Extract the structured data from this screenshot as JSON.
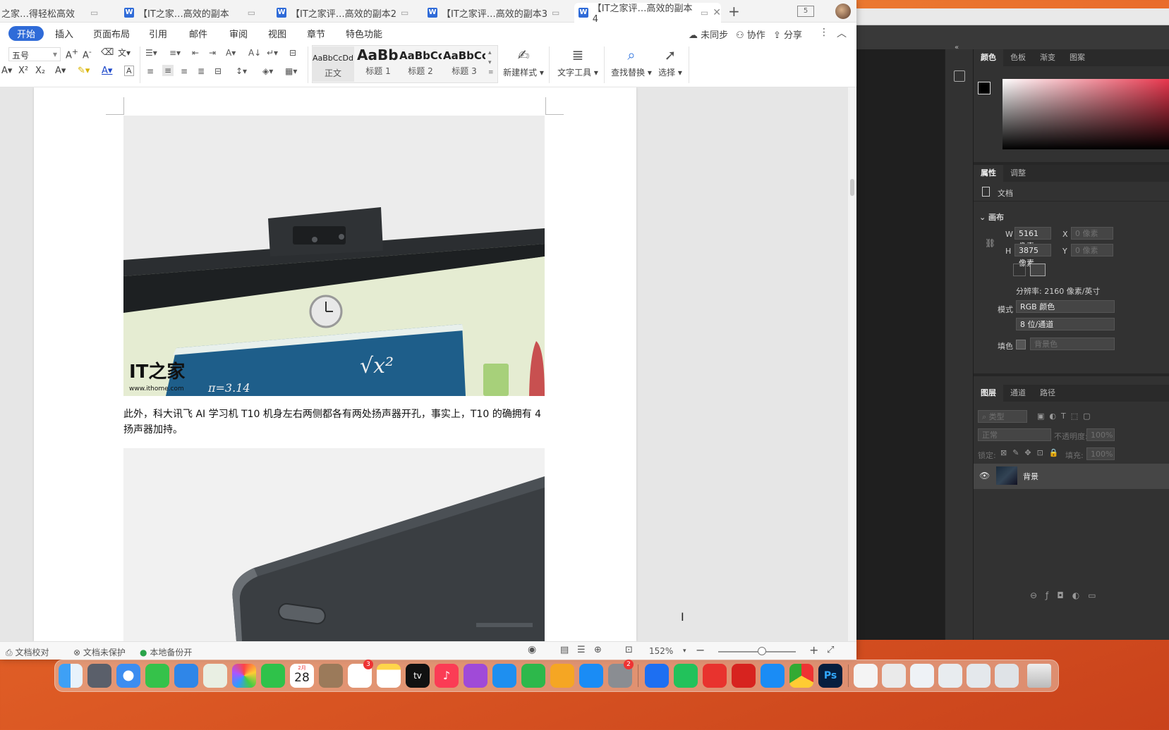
{
  "wps": {
    "tabs": [
      {
        "label": "之家…得轻松高效",
        "active": false
      },
      {
        "label": "【IT之家…高效的副本",
        "active": false
      },
      {
        "label": "【IT之家评…高效的副本2",
        "active": false
      },
      {
        "label": "【IT之家评…高效的副本3",
        "active": false
      },
      {
        "label": "【IT之家评…高效的副本4",
        "active": true
      }
    ],
    "tab_count": "5",
    "menu": [
      "开始",
      "插入",
      "页面布局",
      "引用",
      "邮件",
      "审阅",
      "视图",
      "章节",
      "特色功能"
    ],
    "right_actions": {
      "sync": "未同步",
      "collab": "协作",
      "share": "分享"
    },
    "ribbon": {
      "font_size": "五号",
      "styles": [
        {
          "preview": "AaBbCcDd",
          "name": "正文"
        },
        {
          "preview": "AaBb(",
          "name": "标题 1"
        },
        {
          "preview": "AaBbCc",
          "name": "标题 2"
        },
        {
          "preview": "AaBbCc",
          "name": "标题 3"
        }
      ],
      "new_style": "新建样式",
      "text_tools": "文字工具",
      "find_replace": "查找替换",
      "select": "选择"
    },
    "paragraph": "此外，科大讯飞 AI 学习机 T10 机身左右两侧都各有两处扬声器开孔，事实上，T10 的确拥有 4 扬声器加持。",
    "image1_watermark_logo": "IT之家",
    "image1_watermark_url": "www.ithome.com",
    "image1_board_text": "√x²",
    "image1_board_text2": "π=3.14",
    "status": {
      "proofread": "文档校对",
      "protect": "文档未保护",
      "backup": "本地备份开",
      "zoom": "152%"
    }
  },
  "photoshop": {
    "tabs_top": [
      "颜色",
      "色板",
      "渐变",
      "图案"
    ],
    "tabs_props": [
      "属性",
      "调整"
    ],
    "doc_label": "文档",
    "canvas_section": "画布",
    "w_label": "W",
    "w_value": "5161 像素",
    "h_label": "H",
    "h_value": "3875 像素",
    "x_label": "X",
    "y_label": "Y",
    "xy_placeholder": "0 像素",
    "resolution": "分辨率: 2160 像素/英寸",
    "mode_label": "模式",
    "mode_value": "RGB 颜色",
    "depth_value": "8 位/通道",
    "fill_label": "填色",
    "fill_value": "背景色",
    "tabs_layers": [
      "图层",
      "通道",
      "路径"
    ],
    "layer_filter": "类型",
    "blend_mode": "正常",
    "opacity_label": "不透明度:",
    "opacity_value": "100%",
    "lock_label": "锁定:",
    "fill_short": "填充:",
    "layer_name": "背景"
  },
  "dock": {
    "calendar_month": "2月",
    "calendar_day": "28",
    "badge_reminders": "3",
    "badge_settings": "2",
    "tv_label": "tv"
  }
}
